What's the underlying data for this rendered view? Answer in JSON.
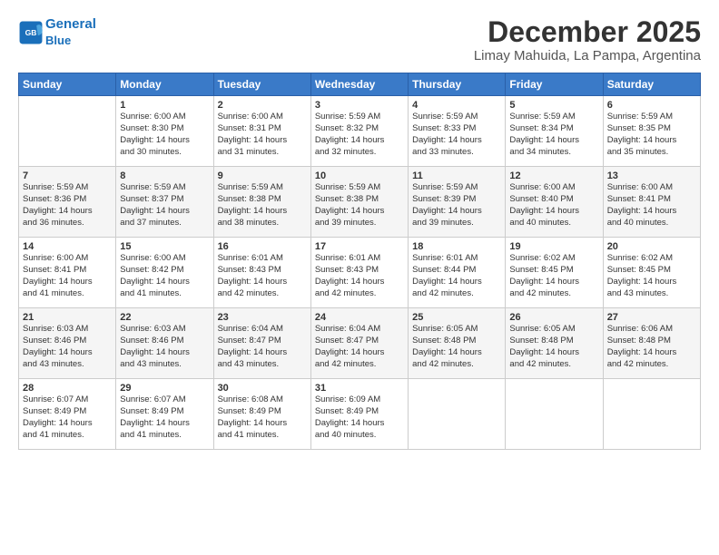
{
  "logo": {
    "line1": "General",
    "line2": "Blue"
  },
  "title": "December 2025",
  "subtitle": "Limay Mahuida, La Pampa, Argentina",
  "days_header": [
    "Sunday",
    "Monday",
    "Tuesday",
    "Wednesday",
    "Thursday",
    "Friday",
    "Saturday"
  ],
  "weeks": [
    [
      {
        "num": "",
        "info": ""
      },
      {
        "num": "1",
        "info": "Sunrise: 6:00 AM\nSunset: 8:30 PM\nDaylight: 14 hours\nand 30 minutes."
      },
      {
        "num": "2",
        "info": "Sunrise: 6:00 AM\nSunset: 8:31 PM\nDaylight: 14 hours\nand 31 minutes."
      },
      {
        "num": "3",
        "info": "Sunrise: 5:59 AM\nSunset: 8:32 PM\nDaylight: 14 hours\nand 32 minutes."
      },
      {
        "num": "4",
        "info": "Sunrise: 5:59 AM\nSunset: 8:33 PM\nDaylight: 14 hours\nand 33 minutes."
      },
      {
        "num": "5",
        "info": "Sunrise: 5:59 AM\nSunset: 8:34 PM\nDaylight: 14 hours\nand 34 minutes."
      },
      {
        "num": "6",
        "info": "Sunrise: 5:59 AM\nSunset: 8:35 PM\nDaylight: 14 hours\nand 35 minutes."
      }
    ],
    [
      {
        "num": "7",
        "info": "Sunrise: 5:59 AM\nSunset: 8:36 PM\nDaylight: 14 hours\nand 36 minutes."
      },
      {
        "num": "8",
        "info": "Sunrise: 5:59 AM\nSunset: 8:37 PM\nDaylight: 14 hours\nand 37 minutes."
      },
      {
        "num": "9",
        "info": "Sunrise: 5:59 AM\nSunset: 8:38 PM\nDaylight: 14 hours\nand 38 minutes."
      },
      {
        "num": "10",
        "info": "Sunrise: 5:59 AM\nSunset: 8:38 PM\nDaylight: 14 hours\nand 39 minutes."
      },
      {
        "num": "11",
        "info": "Sunrise: 5:59 AM\nSunset: 8:39 PM\nDaylight: 14 hours\nand 39 minutes."
      },
      {
        "num": "12",
        "info": "Sunrise: 6:00 AM\nSunset: 8:40 PM\nDaylight: 14 hours\nand 40 minutes."
      },
      {
        "num": "13",
        "info": "Sunrise: 6:00 AM\nSunset: 8:41 PM\nDaylight: 14 hours\nand 40 minutes."
      }
    ],
    [
      {
        "num": "14",
        "info": "Sunrise: 6:00 AM\nSunset: 8:41 PM\nDaylight: 14 hours\nand 41 minutes."
      },
      {
        "num": "15",
        "info": "Sunrise: 6:00 AM\nSunset: 8:42 PM\nDaylight: 14 hours\nand 41 minutes."
      },
      {
        "num": "16",
        "info": "Sunrise: 6:01 AM\nSunset: 8:43 PM\nDaylight: 14 hours\nand 42 minutes."
      },
      {
        "num": "17",
        "info": "Sunrise: 6:01 AM\nSunset: 8:43 PM\nDaylight: 14 hours\nand 42 minutes."
      },
      {
        "num": "18",
        "info": "Sunrise: 6:01 AM\nSunset: 8:44 PM\nDaylight: 14 hours\nand 42 minutes."
      },
      {
        "num": "19",
        "info": "Sunrise: 6:02 AM\nSunset: 8:45 PM\nDaylight: 14 hours\nand 42 minutes."
      },
      {
        "num": "20",
        "info": "Sunrise: 6:02 AM\nSunset: 8:45 PM\nDaylight: 14 hours\nand 43 minutes."
      }
    ],
    [
      {
        "num": "21",
        "info": "Sunrise: 6:03 AM\nSunset: 8:46 PM\nDaylight: 14 hours\nand 43 minutes."
      },
      {
        "num": "22",
        "info": "Sunrise: 6:03 AM\nSunset: 8:46 PM\nDaylight: 14 hours\nand 43 minutes."
      },
      {
        "num": "23",
        "info": "Sunrise: 6:04 AM\nSunset: 8:47 PM\nDaylight: 14 hours\nand 43 minutes."
      },
      {
        "num": "24",
        "info": "Sunrise: 6:04 AM\nSunset: 8:47 PM\nDaylight: 14 hours\nand 42 minutes."
      },
      {
        "num": "25",
        "info": "Sunrise: 6:05 AM\nSunset: 8:48 PM\nDaylight: 14 hours\nand 42 minutes."
      },
      {
        "num": "26",
        "info": "Sunrise: 6:05 AM\nSunset: 8:48 PM\nDaylight: 14 hours\nand 42 minutes."
      },
      {
        "num": "27",
        "info": "Sunrise: 6:06 AM\nSunset: 8:48 PM\nDaylight: 14 hours\nand 42 minutes."
      }
    ],
    [
      {
        "num": "28",
        "info": "Sunrise: 6:07 AM\nSunset: 8:49 PM\nDaylight: 14 hours\nand 41 minutes."
      },
      {
        "num": "29",
        "info": "Sunrise: 6:07 AM\nSunset: 8:49 PM\nDaylight: 14 hours\nand 41 minutes."
      },
      {
        "num": "30",
        "info": "Sunrise: 6:08 AM\nSunset: 8:49 PM\nDaylight: 14 hours\nand 41 minutes."
      },
      {
        "num": "31",
        "info": "Sunrise: 6:09 AM\nSunset: 8:49 PM\nDaylight: 14 hours\nand 40 minutes."
      },
      {
        "num": "",
        "info": ""
      },
      {
        "num": "",
        "info": ""
      },
      {
        "num": "",
        "info": ""
      }
    ]
  ]
}
